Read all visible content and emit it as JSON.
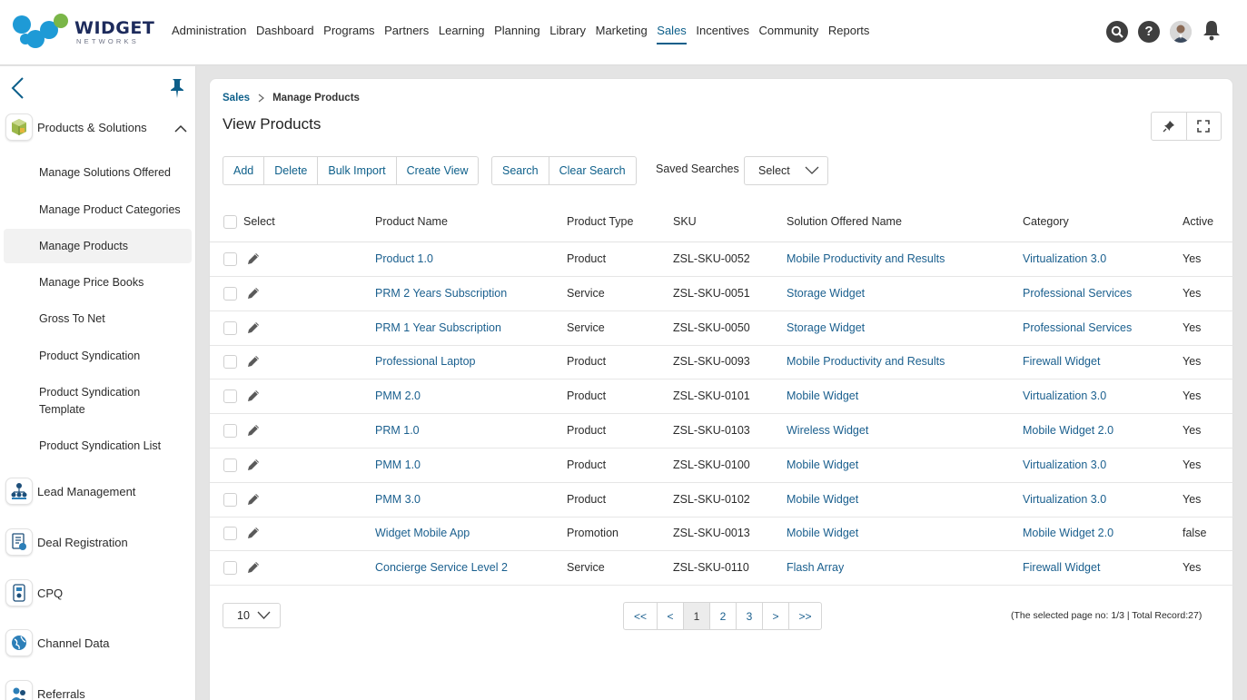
{
  "brand": {
    "name": "WIDGET",
    "sub": "NETWORKS"
  },
  "nav": {
    "items": [
      "Administration",
      "Dashboard",
      "Programs",
      "Partners",
      "Learning",
      "Planning",
      "Library",
      "Marketing",
      "Sales",
      "Incentives",
      "Community",
      "Reports"
    ],
    "active": "Sales"
  },
  "top_icons": [
    "search-icon",
    "help-icon",
    "avatar",
    "bell-icon"
  ],
  "sidebar": {
    "products_section": "Products & Solutions",
    "sub_items": [
      "Manage Solutions Offered",
      "Manage Product Categories",
      "Manage Products",
      "Manage Price Books",
      "Gross To Net",
      "Product Syndication",
      "Product Syndication",
      "Template",
      "Product Syndication List"
    ],
    "selected": "Manage Products",
    "sections": [
      "Lead Management",
      "Deal Registration",
      "CPQ",
      "Channel Data",
      "Referrals"
    ]
  },
  "breadcrumb": {
    "parent": "Sales",
    "current": "Manage Products"
  },
  "page_title": "View Products",
  "toolbar": {
    "add": "Add",
    "delete": "Delete",
    "bulk_import": "Bulk Import",
    "create_view": "Create View",
    "search": "Search",
    "clear_search": "Clear Search",
    "saved_searches_label": "Saved Searches",
    "saved_searches_value": "Select"
  },
  "table": {
    "select_label": "Select",
    "columns": [
      "Product Name",
      "Product Type",
      "SKU",
      "Solution Offered Name",
      "Category",
      "Active"
    ],
    "rows": [
      [
        "Product 1.0",
        "Product",
        "ZSL-SKU-0052",
        "Mobile Productivity and Results",
        "Virtualization 3.0",
        "Yes"
      ],
      [
        "PRM 2 Years Subscription",
        "Service",
        "ZSL-SKU-0051",
        "Storage Widget",
        "Professional Services",
        "Yes"
      ],
      [
        "PRM 1 Year Subscription",
        "Service",
        "ZSL-SKU-0050",
        "Storage Widget",
        "Professional Services",
        "Yes"
      ],
      [
        "Professional Laptop",
        "Product",
        "ZSL-SKU-0093",
        "Mobile Productivity and Results",
        "Firewall Widget",
        "Yes"
      ],
      [
        "PMM 2.0",
        "Product",
        "ZSL-SKU-0101",
        "Mobile Widget",
        "Virtualization 3.0",
        "Yes"
      ],
      [
        "PRM 1.0",
        "Product",
        "ZSL-SKU-0103",
        "Wireless Widget",
        "Mobile Widget 2.0",
        "Yes"
      ],
      [
        "PMM 1.0",
        "Product",
        "ZSL-SKU-0100",
        "Mobile Widget",
        "Virtualization 3.0",
        "Yes"
      ],
      [
        "PMM 3.0",
        "Product",
        "ZSL-SKU-0102",
        "Mobile Widget",
        "Virtualization 3.0",
        "Yes"
      ],
      [
        "Widget Mobile App",
        "Promotion",
        "ZSL-SKU-0013",
        "Mobile Widget",
        "Mobile Widget 2.0",
        "false"
      ],
      [
        "Concierge Service Level 2",
        "Service",
        "ZSL-SKU-0110",
        "Flash Array",
        "Firewall Widget",
        "Yes"
      ]
    ]
  },
  "pagination": {
    "page_size": "10",
    "buttons": [
      "<<",
      "<",
      "1",
      "2",
      "3",
      ">",
      ">>"
    ],
    "current": "1",
    "info": "(The selected page no: 1/3 | Total Record:27)"
  },
  "colors": {
    "accent": "#0d5f8a",
    "link": "#1a5f8e",
    "logo_blue": "#1e9ad6",
    "logo_green": "#7ab648"
  }
}
